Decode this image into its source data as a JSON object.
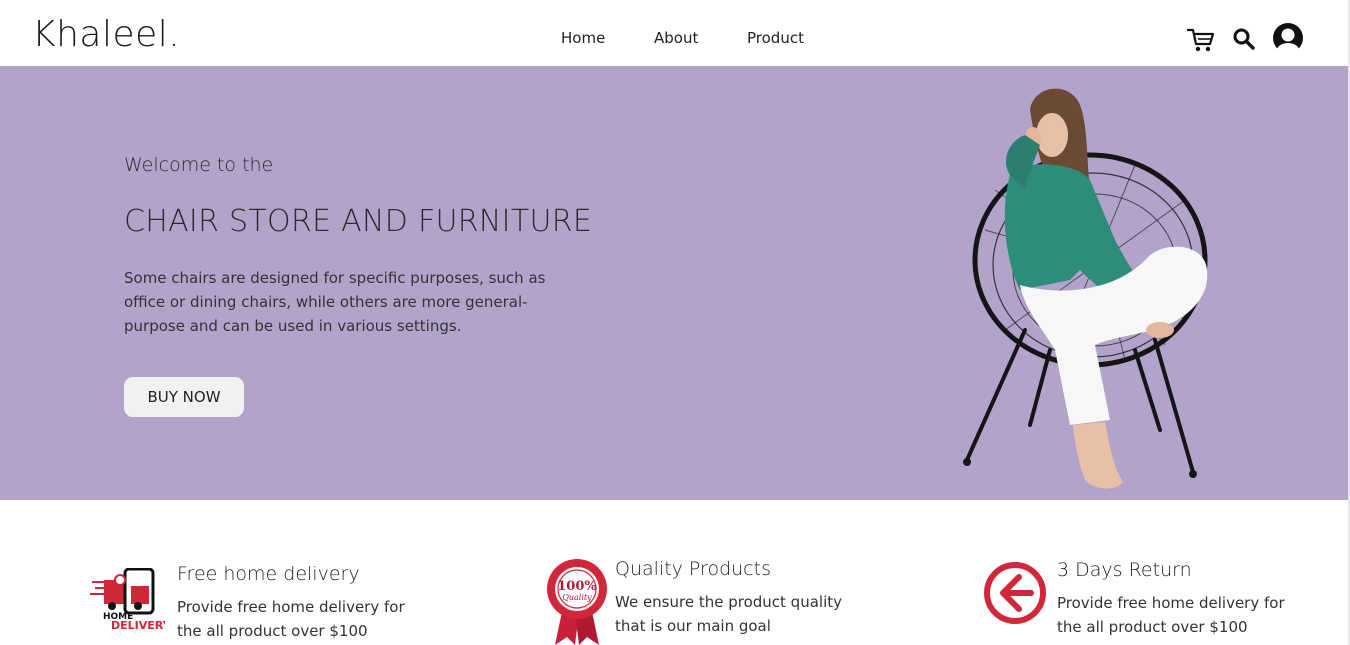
{
  "brand": {
    "logo": "Khaleel."
  },
  "nav": {
    "items": [
      "Home",
      "About",
      "Product"
    ]
  },
  "header_icons": [
    "cart-icon",
    "search-icon",
    "user-avatar-icon"
  ],
  "hero": {
    "welcome": "Welcome to the",
    "title": "CHAIR STORE AND FURNITURE",
    "description": "Some chairs are designed for specific purposes, such as office or dining chairs, while others are more general-purpose and can be used in various settings.",
    "button": "BUY NOW",
    "background": "#b2a3cb",
    "image": "woman-on-chair-illustration"
  },
  "features": [
    {
      "icon": "home-delivery-icon",
      "icon_text_top": "HOME",
      "icon_text_bottom": "DELIVERY",
      "title": "Free home delivery",
      "text": "Provide free home delivery for the all product over $100"
    },
    {
      "icon": "quality-badge-icon",
      "icon_text_top": "100%",
      "icon_text_bottom": "Quality",
      "title": "Quality Products",
      "text": "We ensure the product quality that is our main goal"
    },
    {
      "icon": "return-arrow-icon",
      "title": "3 Days Return",
      "text": "Provide free home delivery for the all product over $100"
    }
  ],
  "colors": {
    "accent_red": "#d0283a",
    "hero_bg": "#b2a3cb",
    "sweater": "#2e8c7a"
  }
}
